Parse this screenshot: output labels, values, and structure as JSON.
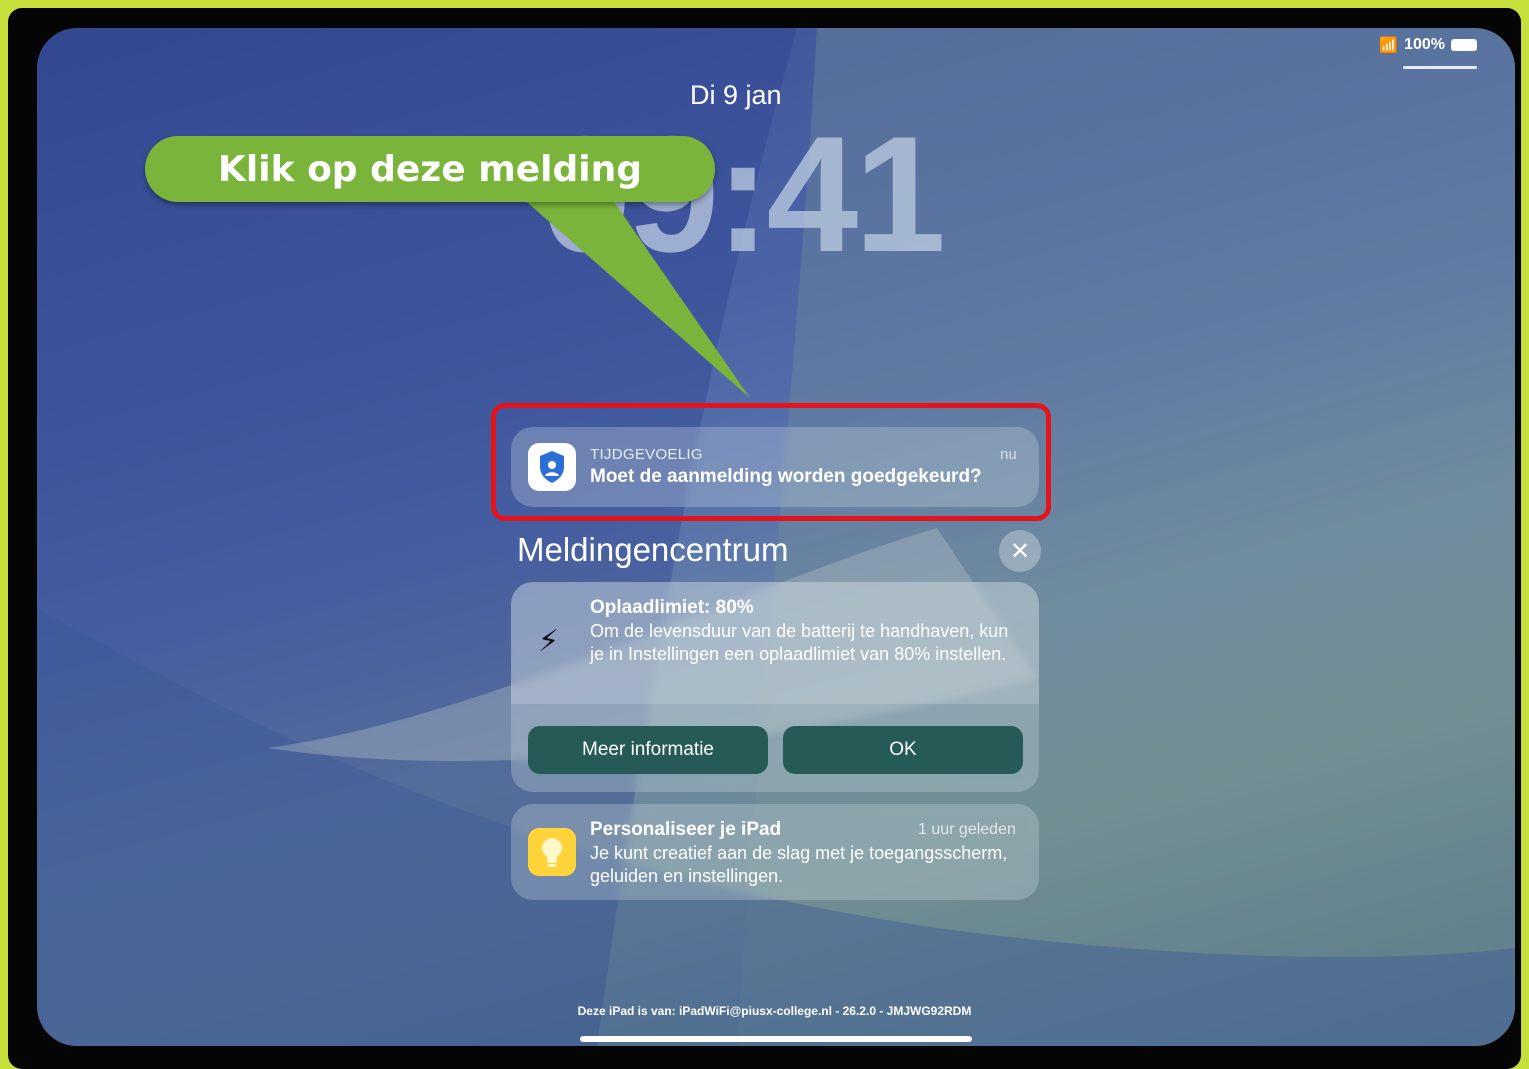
{
  "status_bar": {
    "battery": "100%"
  },
  "lock_screen": {
    "date": "Di 9 jan",
    "time": "09:41"
  },
  "callout": {
    "text": "Klik op deze melding"
  },
  "notifications": {
    "auth": {
      "label": "TIJDGEVOELIG",
      "time": "nu",
      "title": "Moet de aanmelding worden goedgekeurd?"
    },
    "center_title": "Meldingencentrum",
    "charge": {
      "title": "Oplaadlimiet: 80%",
      "body": "Om de levensduur van de batterij te handhaven, kun je in Instellingen een oplaadlimiet van 80% instellen.",
      "button_more": "Meer informatie",
      "button_ok": "OK"
    },
    "tips": {
      "title": "Personaliseer je iPad",
      "time": "1 uur geleden",
      "body": "Je kunt creatief aan de slag met je toegangsscherm, geluiden en instellingen."
    }
  },
  "footer": {
    "text": "Deze iPad is van: iPadWiFi@piusx-college.nl - 26.2.0 - JMJWG92RDM"
  },
  "colors": {
    "callout": "#7ab43b",
    "highlight": "#e3141c",
    "button": "#255a56",
    "tips_icon": "#ffd33a"
  }
}
